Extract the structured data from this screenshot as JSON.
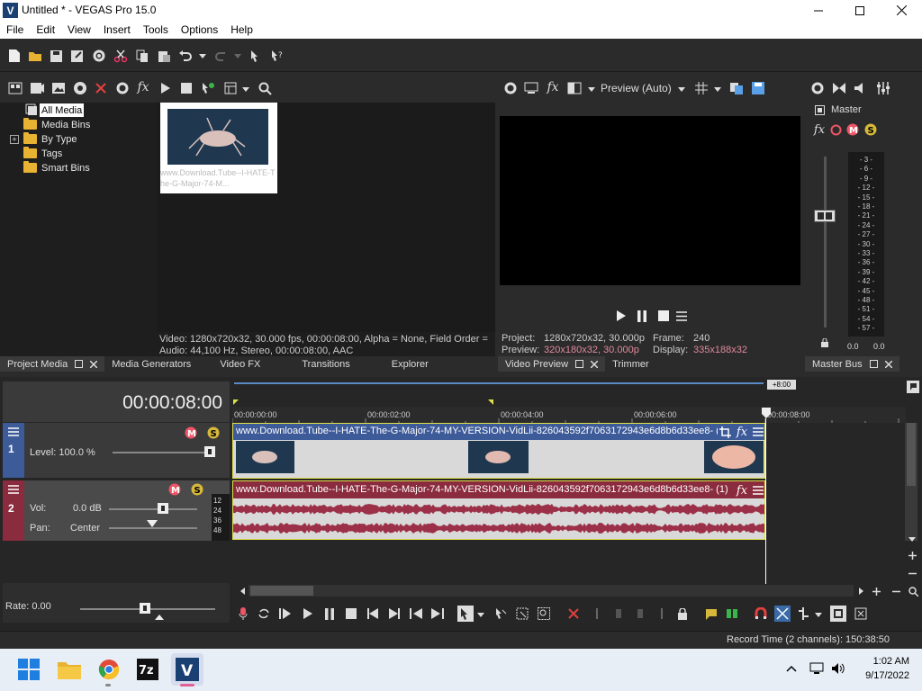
{
  "window": {
    "title": "Untitled * - VEGAS Pro 15.0",
    "app_icon_letter": "V"
  },
  "menu": [
    "File",
    "Edit",
    "View",
    "Insert",
    "Tools",
    "Options",
    "Help"
  ],
  "explorer": {
    "tree": [
      "All Media",
      "Media Bins",
      "By Type",
      "Tags",
      "Smart Bins"
    ],
    "thumbnail_caption": "www.Download.Tube--I-HATE-The-G-Major-74-M...",
    "video_info": "Video: 1280x720x32, 30.000 fps, 00:00:08:00, Alpha = None, Field Order =",
    "audio_info": "Audio: 44,100 Hz, Stereo, 00:00:08:00, AAC",
    "tabs": [
      "Project Media",
      "Media Generators",
      "Video FX",
      "Transitions",
      "Explorer"
    ]
  },
  "preview": {
    "mode": "Preview (Auto)",
    "project_label": "Project:",
    "project_value": "1280x720x32, 30.000p",
    "frame_label": "Frame:",
    "frame_value": "240",
    "preview_label": "Preview:",
    "preview_value": "320x180x32, 30.000p",
    "display_label": "Display:",
    "display_value": "335x188x32",
    "tabs": [
      "Video Preview",
      "Trimmer"
    ]
  },
  "master": {
    "label": "Master",
    "scale": [
      "3",
      "6",
      "9",
      "12",
      "15",
      "18",
      "21",
      "24",
      "27",
      "30",
      "33",
      "36",
      "39",
      "42",
      "45",
      "48",
      "51",
      "54",
      "57"
    ],
    "left_value": "0.0",
    "right_value": "0.0",
    "tab": "Master Bus"
  },
  "timeline": {
    "current_time": "00:00:08:00",
    "marker_offset": "+8:00",
    "ruler": [
      "00:00:00:00",
      "00:00:02:00",
      "00:00:04:00",
      "00:00:06:00",
      "00:00:08:00"
    ],
    "video_track": {
      "number": "1",
      "level_label": "Level: 100.0 %",
      "clip_name": "www.Download.Tube--I-HATE-The-G-Major-74-MY-VERSION-VidLii-826043592f7063172943e6d8b6d33ee8- (1)"
    },
    "audio_track": {
      "number": "2",
      "vol_label": "Vol:",
      "vol_value": "0.0 dB",
      "pan_label": "Pan:",
      "pan_value": "Center",
      "meter_scale": [
        "12",
        "24",
        "36",
        "48"
      ],
      "clip_name": "www.Download.Tube--I-HATE-The-G-Major-74-MY-VERSION-VidLii-826043592f7063172943e6d8b6d33ee8- (1)"
    },
    "rate_label": "Rate: 0.00"
  },
  "status": {
    "record_time": "Record Time (2 channels): 150:38:50"
  },
  "taskbar": {
    "time": "1:02 AM",
    "date": "9/17/2022",
    "apps": [
      "start-icon",
      "file-explorer-icon",
      "chrome-icon",
      "7zip-icon",
      "vegas-icon"
    ]
  },
  "colors": {
    "video_track": "#3d5a99",
    "audio_track": "#8b2b3e",
    "selection_yellow": "#e0e04a",
    "waveform": "#9c3048"
  }
}
